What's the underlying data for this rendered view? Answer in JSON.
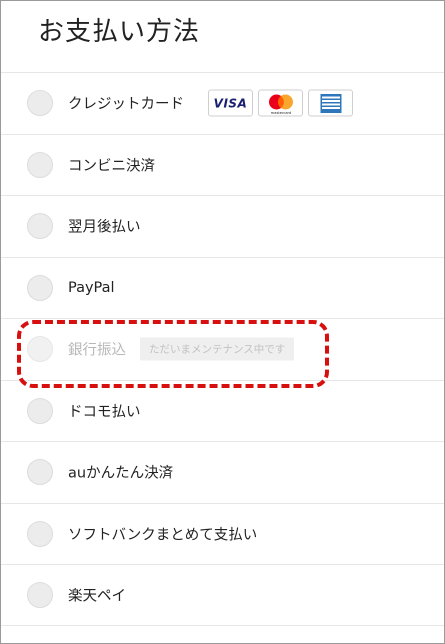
{
  "page": {
    "title": "お支払い方法"
  },
  "payment_methods": [
    {
      "label": "クレジットカード",
      "cards": [
        "VISA",
        "mastercard",
        "American Express"
      ]
    },
    {
      "label": "コンビニ決済"
    },
    {
      "label": "翌月後払い"
    },
    {
      "label": "PayPal"
    },
    {
      "label": "銀行振込",
      "disabled": true,
      "note": "ただいまメンテナンス中です"
    },
    {
      "label": "ドコモ払い"
    },
    {
      "label": "auかんたん決済"
    },
    {
      "label": "ソフトバンクまとめて支払い"
    },
    {
      "label": "楽天ペイ"
    }
  ],
  "card_logos": {
    "visa_text": "VISA",
    "mastercard_text": "mastercard"
  },
  "colors": {
    "highlight": "#d80f0f",
    "visa_blue": "#1a1f71",
    "mastercard_red": "#eb001b",
    "mastercard_orange": "#f79e1b",
    "amex_blue": "#2e77bb",
    "radio_fill": "#ececec"
  }
}
